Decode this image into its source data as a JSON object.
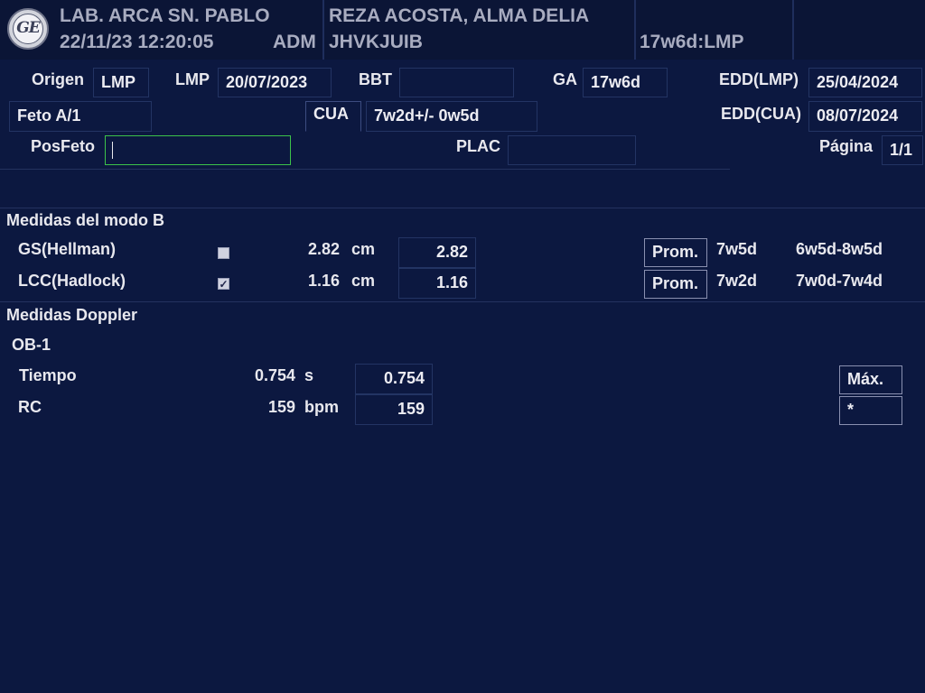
{
  "header": {
    "institution": "LAB. ARCA SN. PABLO",
    "datetime": "22/11/23 12:20:05",
    "operator": "ADM",
    "patient_name": "REZA ACOSTA, ALMA DELIA",
    "patient_id": "JHVKJUIB",
    "gestational_age": "17w6d:LMP",
    "logo_text": "GE"
  },
  "patient_info": {
    "origen_label": "Origen",
    "origen_value": "LMP",
    "lmp_label": "LMP",
    "lmp_value": "20/07/2023",
    "bbt_label": "BBT",
    "bbt_value": "",
    "ga_label": "GA",
    "ga_value": "17w6d",
    "edd_lmp_label": "EDD(LMP)",
    "edd_lmp_value": "25/04/2024",
    "feto_value": "Feto A/1",
    "cua_label": "CUA",
    "cua_value": "7w2d+/- 0w5d",
    "edd_cua_label": "EDD(CUA)",
    "edd_cua_value": "08/07/2024",
    "posfeto_label": "PosFeto",
    "posfeto_value": "",
    "plac_label": "PLAC",
    "plac_value": "",
    "pagina_label": "Página",
    "pagina_value": "1/1"
  },
  "bmode": {
    "title": "Medidas del modo B",
    "rows": [
      {
        "name": "GS(Hellman)",
        "checked": false,
        "measure": "2.82",
        "unit": "cm",
        "value": "2.82",
        "method": "Prom.",
        "ga": "7w5d",
        "range": "6w5d-8w5d"
      },
      {
        "name": "LCC(Hadlock)",
        "checked": true,
        "measure": "1.16",
        "unit": "cm",
        "value": "1.16",
        "method": "Prom.",
        "ga": "7w2d",
        "range": "7w0d-7w4d"
      }
    ]
  },
  "doppler": {
    "title": "Medidas Doppler",
    "subsection": "OB-1",
    "rows": [
      {
        "name": "Tiempo",
        "measure": "0.754",
        "unit": "s",
        "value": "0.754",
        "method": "Máx."
      },
      {
        "name": "RC",
        "measure": "159",
        "unit": "bpm",
        "value": "159",
        "method": "*"
      }
    ]
  },
  "colors": {
    "background": "#0c1840",
    "header_background": "#0b1536",
    "active_field_border": "#3cc24a"
  }
}
